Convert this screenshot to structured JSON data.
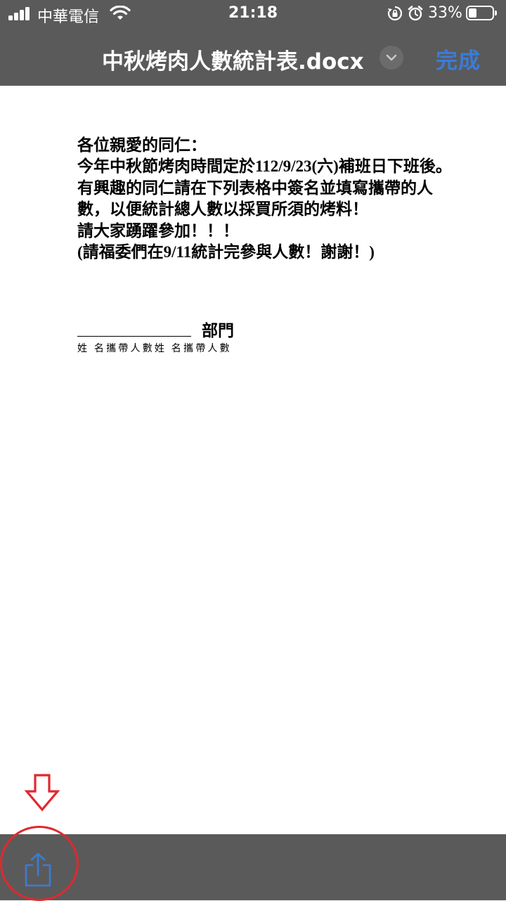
{
  "status_bar": {
    "carrier": "中華電信",
    "time": "21:18",
    "battery_percent": "33%",
    "battery_level": 0.33,
    "icons": [
      "signal-icon",
      "wifi-icon",
      "rotation-lock-icon",
      "alarm-icon",
      "battery-icon"
    ]
  },
  "nav": {
    "title": "中秋烤肉人數統計表.docx",
    "done_label": "完成",
    "accent_color": "#3a7cd8"
  },
  "document": {
    "paragraphs": [
      "各位親愛的同仁：",
      "今年中秋節烤肉時間定於112/9/23(六)補班日下班後。",
      "有興趣的同仁請在下列表格中簽名並填寫攜帶的人數，以便統計總人數以採買所須的烤料！",
      "請大家踴躍參加！！！",
      "(請福委們在9/11統計完參與人數！謝謝！)"
    ],
    "department_label": "部門",
    "column_headers": "姓 名攜帶人數姓 名攜帶人數"
  },
  "toolbar": {
    "share_icon": "share-icon"
  },
  "annotations": {
    "color": "#e0292f",
    "shapes": [
      "down-arrow",
      "circle"
    ]
  }
}
